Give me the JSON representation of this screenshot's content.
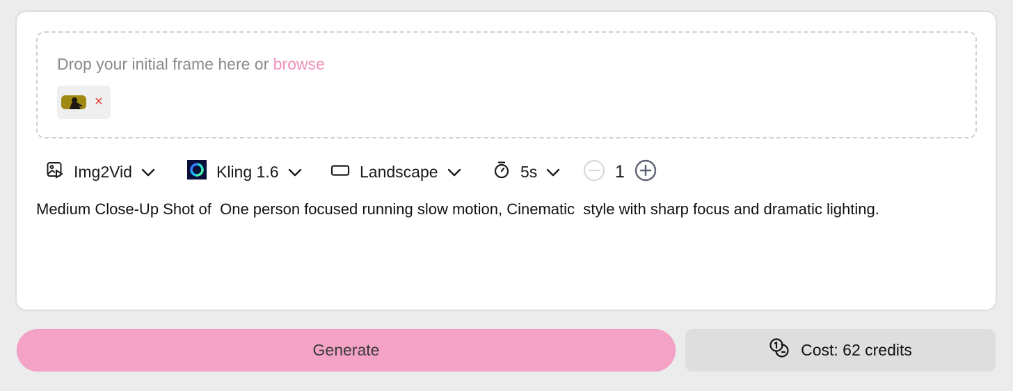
{
  "dropzone": {
    "prompt_text": "Drop your initial frame here or ",
    "browse_label": "browse",
    "remove_label": "×"
  },
  "toolbar": {
    "mode": {
      "label": "Img2Vid",
      "icon": "image-to-video-icon"
    },
    "model": {
      "label": "Kling 1.6",
      "icon": "kling-logo-icon"
    },
    "aspect": {
      "label": "Landscape",
      "icon": "landscape-rectangle-icon"
    },
    "duration": {
      "label": "5s",
      "icon": "stopwatch-icon"
    },
    "count": {
      "value": "1"
    }
  },
  "prompt": {
    "text": "Medium Close-Up Shot of  One person focused running slow motion, Cinematic  style with sharp focus and dramatic lighting."
  },
  "actions": {
    "generate_label": "Generate",
    "cost_label": "Cost: 62 credits"
  },
  "colors": {
    "accent_pink": "#f4a3c6",
    "browse_link": "#ef8fb9",
    "remove": "#e53935"
  }
}
